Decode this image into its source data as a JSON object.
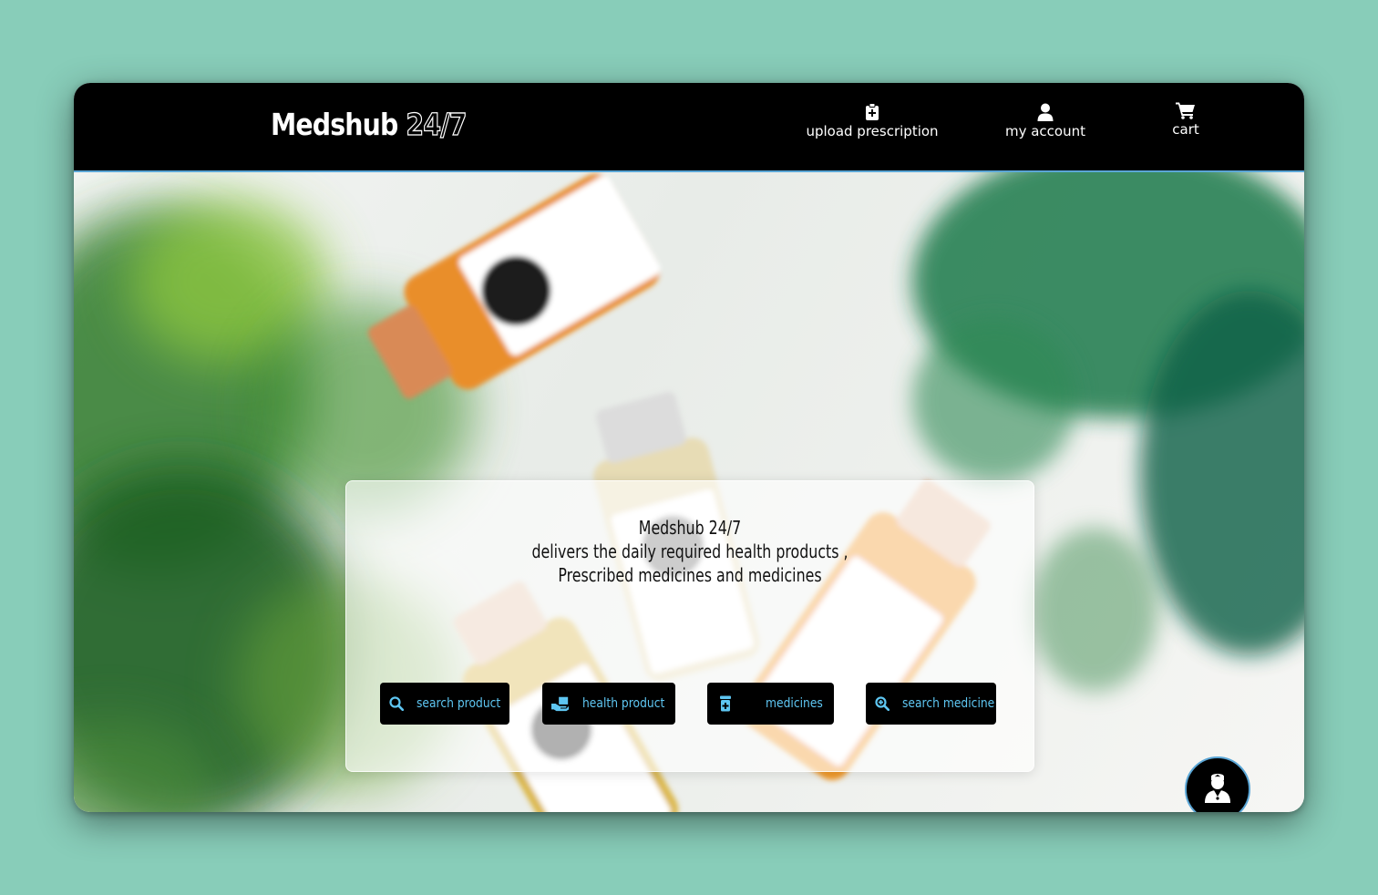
{
  "header": {
    "brand_name": "Medshub",
    "brand_number": "24/7",
    "nav": [
      {
        "label": "upload prescription",
        "icon": "clipboard-plus-icon"
      },
      {
        "label": "my account",
        "icon": "user-icon"
      },
      {
        "label": "cart",
        "icon": "cart-icon"
      }
    ]
  },
  "hero": {
    "title": "Medshub 24/7",
    "line1": "delivers the daily required health products ,",
    "line2": "Prescribed medicines and medicines",
    "buttons": [
      {
        "label": "search product",
        "icon": "search-icon"
      },
      {
        "label": "health product",
        "icon": "hand-box-icon"
      },
      {
        "label": "medicines",
        "icon": "pill-bottle-icon"
      },
      {
        "label": "search medicine",
        "icon": "zoom-plus-icon"
      }
    ]
  },
  "chat": {
    "icon": "doctor-icon"
  },
  "colors": {
    "page_background": "#88cdb9",
    "navbar": "#000000",
    "accent": "#5ec6f2",
    "nav_border": "#5aa6d6"
  }
}
